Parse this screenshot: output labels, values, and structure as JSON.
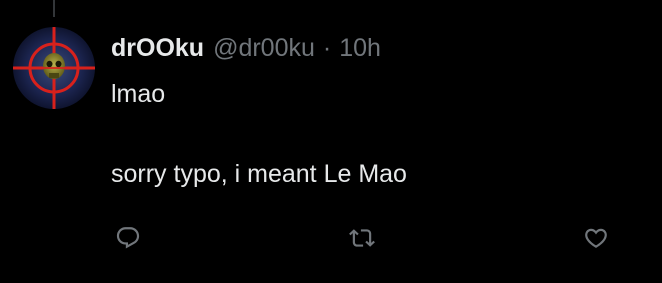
{
  "post": {
    "author_name": "drOOku",
    "author_handle": "@dr00ku",
    "separator": "·",
    "timestamp": "10h",
    "text_lines": [
      "lmao",
      "sorry typo, i meant Le Mao"
    ]
  },
  "actions": [
    {
      "name": "reply",
      "icon": "reply-icon"
    },
    {
      "name": "repost",
      "icon": "repost-icon"
    },
    {
      "name": "like",
      "icon": "heart-icon"
    }
  ],
  "colors": {
    "background": "#000000",
    "primary_text": "#e7e9ea",
    "secondary_text": "#71767b",
    "thread_line": "#333639",
    "avatar_crosshair": "#d8211c"
  }
}
